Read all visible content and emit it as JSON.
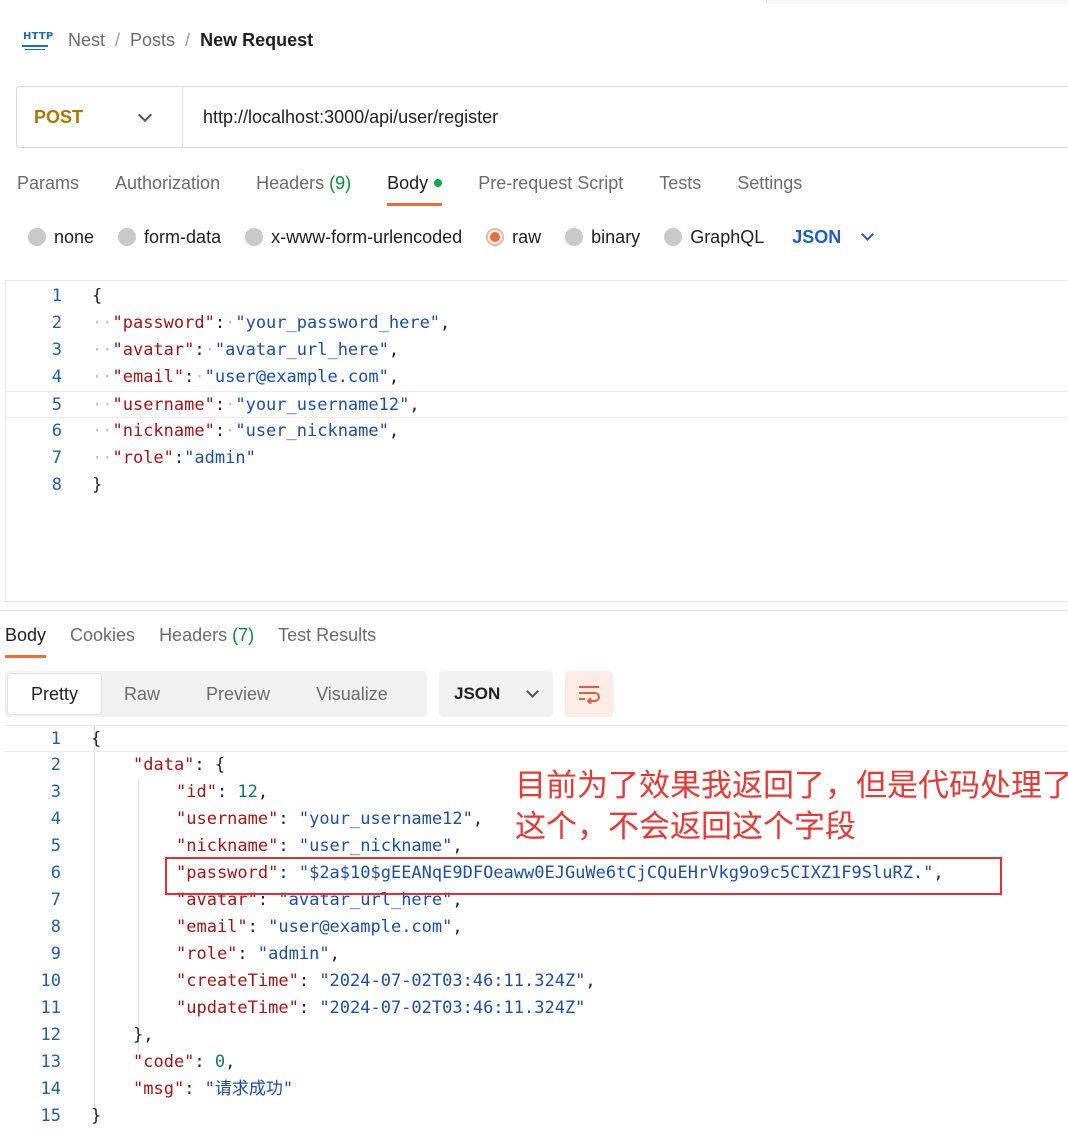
{
  "breadcrumb": {
    "icon": "http-icon",
    "items": [
      "Nest",
      "Posts"
    ],
    "current": "New Request"
  },
  "request": {
    "method": "POST",
    "url": "http://localhost:3000/api/user/register"
  },
  "request_tabs": [
    {
      "label": "Params",
      "count": ""
    },
    {
      "label": "Authorization",
      "count": ""
    },
    {
      "label": "Headers",
      "count": "(9)"
    },
    {
      "label": "Body",
      "count": ""
    },
    {
      "label": "Pre-request Script",
      "count": ""
    },
    {
      "label": "Tests",
      "count": ""
    },
    {
      "label": "Settings",
      "count": ""
    }
  ],
  "active_request_tab": "Body",
  "body_types": [
    "none",
    "form-data",
    "x-www-form-urlencoded",
    "raw",
    "binary",
    "GraphQL"
  ],
  "selected_body_type": "raw",
  "raw_language": "JSON",
  "request_body_lines": [
    "{",
    "\"password\": \"your_password_here\",",
    "\"avatar\": \"avatar_url_here\",",
    "\"email\": \"user@example.com\",",
    "\"username\": \"your_username12\",",
    "\"nickname\": \"user_nickname\",",
    "\"role\":\"admin\"",
    "}"
  ],
  "response_tabs": [
    {
      "label": "Body",
      "count": ""
    },
    {
      "label": "Cookies",
      "count": ""
    },
    {
      "label": "Headers",
      "count": "(7)"
    },
    {
      "label": "Test Results",
      "count": ""
    }
  ],
  "active_response_tab": "Body",
  "view_modes": [
    "Pretty",
    "Raw",
    "Preview",
    "Visualize"
  ],
  "active_view_mode": "Pretty",
  "response_format": "JSON",
  "wrap_icon": "wrap-lines-icon",
  "response_body_lines": [
    "{",
    "\"data\": {",
    "\"id\": 12,",
    "\"username\": \"your_username12\",",
    "\"nickname\": \"user_nickname\",",
    "\"password\": \"$2a$10$gEEANqE9DFOeaww0EJGuWe6tCjCQuEHrVkg9o9c5CIXZ1F9SluRZ.\",",
    "\"avatar\": \"avatar_url_here\",",
    "\"email\": \"user@example.com\",",
    "\"role\": \"admin\",",
    "\"createTime\": \"2024-07-02T03:46:11.324Z\",",
    "\"updateTime\": \"2024-07-02T03:46:11.324Z\"",
    "},",
    "\"code\": 0,",
    "\"msg\": \"请求成功\"",
    "}"
  ],
  "annotation": {
    "text": "目前为了效果我返回了，但是代码处理了这个，不会返回这个字段",
    "color": "#e53935"
  },
  "colors": {
    "accent": "#f26b3a",
    "method": "#a97700",
    "json_key": "#a31515",
    "json_string": "#1a4fa3",
    "json_number": "#0d7a5c",
    "count_green": "#0f8a3b"
  }
}
